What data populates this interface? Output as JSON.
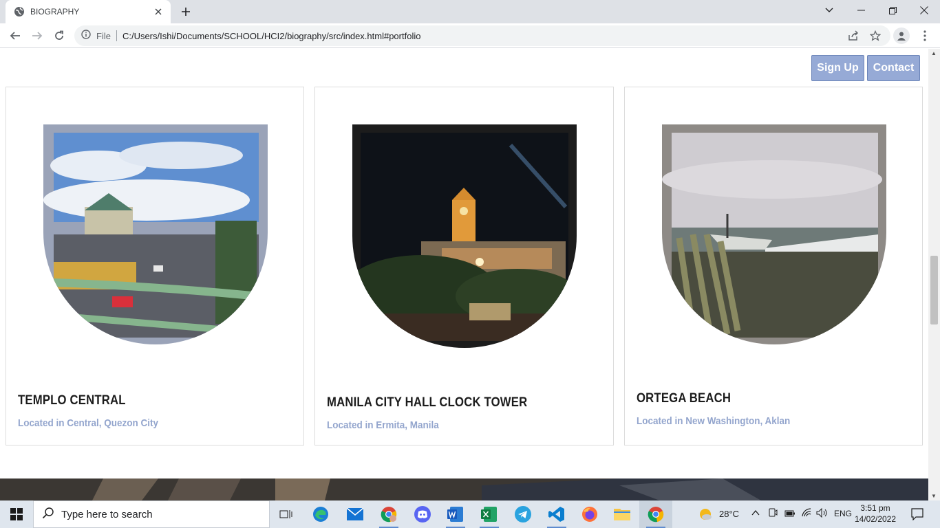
{
  "browser": {
    "tab_title": "BIOGRAPHY",
    "omnibox_scheme": "File",
    "url": "C:/Users/Ishi/Documents/SCHOOL/HCI2/biography/src/index.html#portfolio"
  },
  "page": {
    "nav_buttons": {
      "signup": "Sign Up",
      "contact": "Contact"
    },
    "cards": [
      {
        "title": "TEMPLO CENTRAL",
        "subtitle": "Located in Central, Quezon City"
      },
      {
        "title": "MANILA CITY HALL CLOCK TOWER",
        "subtitle": "Located in Ermita, Manila"
      },
      {
        "title": "ORTEGA BEACH",
        "subtitle": "Located in New Washington, Aklan"
      }
    ],
    "accent_color": "#93a5cd",
    "button_color": "#96aad6"
  },
  "taskbar": {
    "search_placeholder": "Type here to search",
    "weather": "28°C",
    "language": "ENG",
    "time": "3:51 pm",
    "date": "14/02/2022",
    "apps": [
      "task-view",
      "edge",
      "mail",
      "chrome-profile",
      "discord",
      "word",
      "excel",
      "telegram",
      "vscode",
      "firefox",
      "file-explorer",
      "chrome"
    ]
  }
}
